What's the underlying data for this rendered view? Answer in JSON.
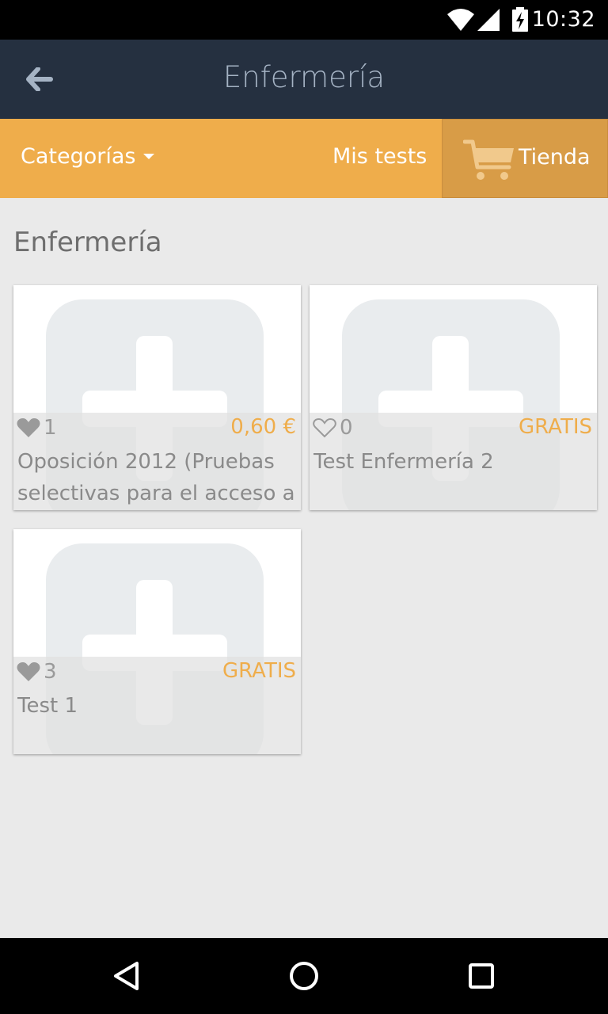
{
  "status_bar": {
    "time": "10:32",
    "icons": [
      "wifi-icon",
      "signal-icon",
      "battery-charging-icon"
    ]
  },
  "app_bar": {
    "back_icon": "arrow-left-icon",
    "title": "Enfermería"
  },
  "nav": {
    "categories_label": "Categorías",
    "my_tests_label": "Mis tests",
    "store_label": "Tienda",
    "store_icon": "shopping-cart-icon"
  },
  "section": {
    "title": "Enfermería"
  },
  "cards": [
    {
      "likes": "1",
      "liked": true,
      "price": "0,60 €",
      "title": "Oposición 2012 (Pruebas selectivas para el acceso a",
      "thumb_icon": "medical-cross-icon"
    },
    {
      "likes": "0",
      "liked": false,
      "price": "GRATIS",
      "title": "Test Enfermería 2",
      "thumb_icon": "medical-cross-icon"
    },
    {
      "likes": "3",
      "liked": true,
      "price": "GRATIS",
      "title": "Test 1",
      "thumb_icon": "medical-cross-icon"
    }
  ],
  "system_nav": {
    "back_icon": "back-triangle-icon",
    "home_icon": "home-circle-icon",
    "recents_icon": "recents-square-icon"
  },
  "colors": {
    "app_bar": "#253040",
    "nav_bar": "#efad4b",
    "store_tab": "#d89c47",
    "price": "#efad4b",
    "background": "#eaeaea"
  }
}
